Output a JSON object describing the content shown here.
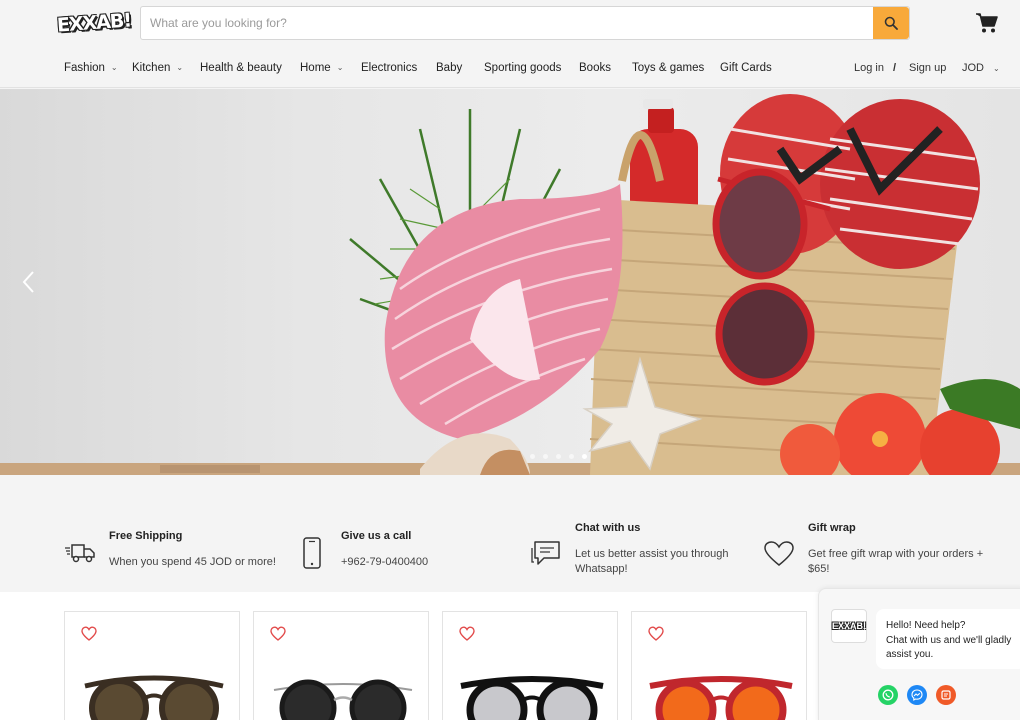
{
  "header": {
    "logo_text": "EXXAB!",
    "search_placeholder": "What are you looking for?",
    "search_icon": "search-icon",
    "cart_icon": "cart-icon"
  },
  "nav": {
    "items": [
      {
        "label": "Fashion",
        "has_dropdown": true
      },
      {
        "label": "Kitchen",
        "has_dropdown": true
      },
      {
        "label": "Health & beauty",
        "has_dropdown": false
      },
      {
        "label": "Home",
        "has_dropdown": true
      },
      {
        "label": "Electronics",
        "has_dropdown": false
      },
      {
        "label": "Baby",
        "has_dropdown": false
      },
      {
        "label": "Sporting goods",
        "has_dropdown": false
      },
      {
        "label": "Books",
        "has_dropdown": false
      },
      {
        "label": "Toys & games",
        "has_dropdown": false
      },
      {
        "label": "Gift Cards",
        "has_dropdown": false
      }
    ],
    "login": "Log in",
    "separator": "/",
    "signup": "Sign up",
    "currency": "JOD"
  },
  "hero": {
    "prev_icon": "chevron-left-icon",
    "slide_count": 5,
    "active_slide": 4
  },
  "features": [
    {
      "icon": "truck-icon",
      "title": "Free Shipping",
      "text": "When you spend 45 JOD or more!"
    },
    {
      "icon": "phone-icon",
      "title": "Give us a call",
      "text": "+962-79-0400400"
    },
    {
      "icon": "chat-icon",
      "title": "Chat with us",
      "text": "Let us better assist you through Whatsapp!"
    },
    {
      "icon": "heart-icon",
      "title": "Gift wrap",
      "text": "Get free gift wrap with your orders + $65!"
    }
  ],
  "products": [
    {
      "wishlist_icon": "heart-icon",
      "lens_color": "#5a4a32",
      "frame_color": "#3a2e22"
    },
    {
      "wishlist_icon": "heart-icon",
      "lens_color": "#2b2b2b",
      "frame_color": "#1a1a1a"
    },
    {
      "wishlist_icon": "heart-icon",
      "lens_color": "#c8c8cc",
      "frame_color": "#111111"
    },
    {
      "wishlist_icon": "heart-icon",
      "lens_color": "#f26a1b",
      "frame_color": "#c0272d"
    }
  ],
  "chat_widget": {
    "avatar_text": "EXXAB!",
    "greeting_line1": "Hello! Need help?",
    "greeting_line2": "Chat with us and we'll gladly assist you.",
    "channels": [
      {
        "icon": "whatsapp-icon",
        "color": "#25d366"
      },
      {
        "icon": "messenger-icon",
        "color": "#1e88f5"
      },
      {
        "icon": "contact-icon",
        "color": "#f05a28"
      }
    ]
  },
  "colors": {
    "accent": "#f8a93a",
    "wishlist": "#e24b4b"
  }
}
